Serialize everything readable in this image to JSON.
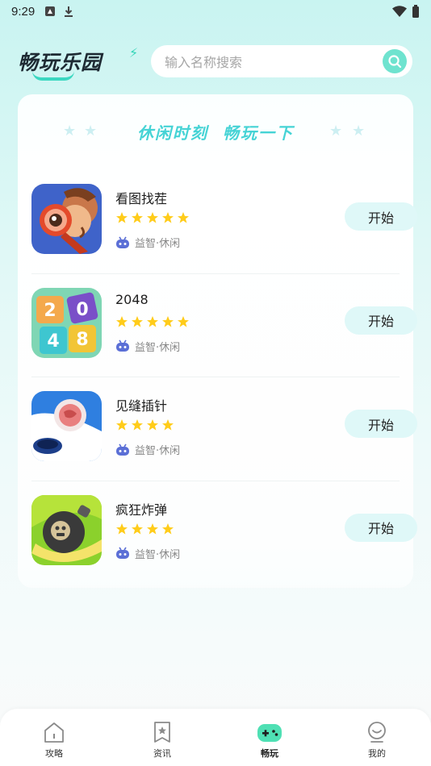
{
  "status_bar": {
    "time": "9:29"
  },
  "app": {
    "logo_text": "畅玩乐园"
  },
  "search": {
    "placeholder": "输入名称搜索"
  },
  "banner": {
    "title": "休闲时刻  畅玩一下"
  },
  "games": [
    {
      "name": "看图找茬",
      "stars": 5,
      "tag": "益智·休闲",
      "button": "开始",
      "icon": "magnifier-game-icon"
    },
    {
      "name": "2048",
      "stars": 5,
      "tag": "益智·休闲",
      "button": "开始",
      "icon": "2048-game-icon"
    },
    {
      "name": "见缝插针",
      "stars": 4,
      "tag": "益智·休闲",
      "button": "开始",
      "icon": "ball-hole-game-icon"
    },
    {
      "name": "疯狂炸弹",
      "stars": 4,
      "tag": "益智·休闲",
      "button": "开始",
      "icon": "bomb-game-icon"
    }
  ],
  "tabs": [
    {
      "label": "攻略",
      "icon": "house-icon"
    },
    {
      "label": "资讯",
      "icon": "bookmark-star-icon"
    },
    {
      "label": "畅玩",
      "icon": "gamepad-icon",
      "active": true
    },
    {
      "label": "我的",
      "icon": "profile-icon"
    }
  ],
  "colors": {
    "accent": "#45d3d5",
    "star": "#ffcc1a",
    "button_bg": "#dff8f8",
    "search_btn": "#6fe3cf"
  }
}
